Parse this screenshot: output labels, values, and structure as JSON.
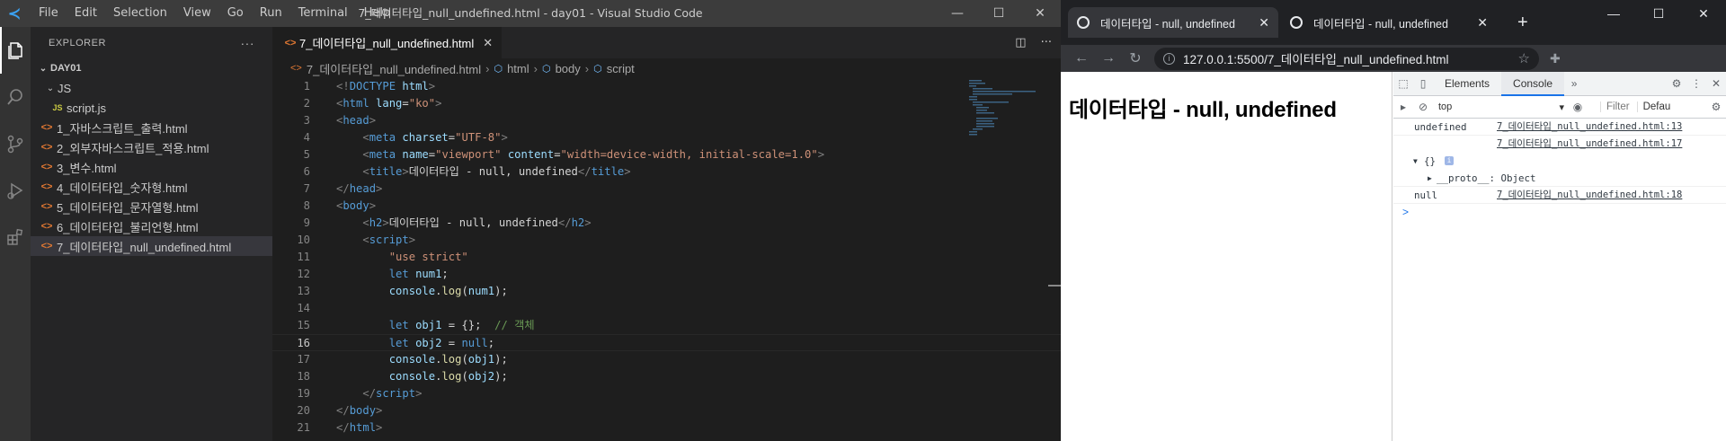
{
  "vscode": {
    "menu": [
      "File",
      "Edit",
      "Selection",
      "View",
      "Go",
      "Run",
      "Terminal",
      "Help"
    ],
    "window_title": "7_데이터타입_null_undefined.html - day01 - Visual Studio Code",
    "explorer_title": "EXPLORER",
    "folder": "DAY01",
    "tree": {
      "js_folder": "JS",
      "js_file": "script.js",
      "files": [
        "1_자바스크립트_출력.html",
        "2_외부자바스크립트_적용.html",
        "3_변수.html",
        "4_데이터타입_숫자형.html",
        "5_데이터타입_문자열형.html",
        "6_데이터타입_불리언형.html",
        "7_데이터타입_null_undefined.html"
      ]
    },
    "tab_label": "7_데이터타입_null_undefined.html",
    "breadcrumb": [
      "7_데이터타입_null_undefined.html",
      "html",
      "body",
      "script"
    ],
    "code_lines": [
      "1",
      "2",
      "3",
      "4",
      "5",
      "6",
      "7",
      "8",
      "9",
      "10",
      "11",
      "12",
      "13",
      "14",
      "15",
      "16",
      "17",
      "18",
      "19",
      "20",
      "21"
    ],
    "current_line": "16"
  },
  "chrome": {
    "tabs": [
      {
        "title": "데이터타입 - null, undefined"
      },
      {
        "title": "데이터타입 - null, undefined"
      }
    ],
    "url": "127.0.0.1:5500/7_데이터타입_null_undefined.html",
    "page_heading": "데이터타입 - null, undefined",
    "devtools": {
      "tabs": [
        "Elements",
        "Console"
      ],
      "active_tab": "Console",
      "context": "top",
      "filter_placeholder": "Filter",
      "levels": "Defau",
      "logs": [
        {
          "value": "undefined",
          "source": "7_데이터타입_null_undefined.html:13"
        },
        {
          "value": "",
          "source": "7_데이터타입_null_undefined.html:17"
        },
        {
          "value": "{}",
          "source": ""
        },
        {
          "value": "__proto__: Object",
          "source": ""
        },
        {
          "value": "null",
          "source": "7_데이터타입_null_undefined.html:18"
        }
      ],
      "prompt": ">"
    }
  }
}
